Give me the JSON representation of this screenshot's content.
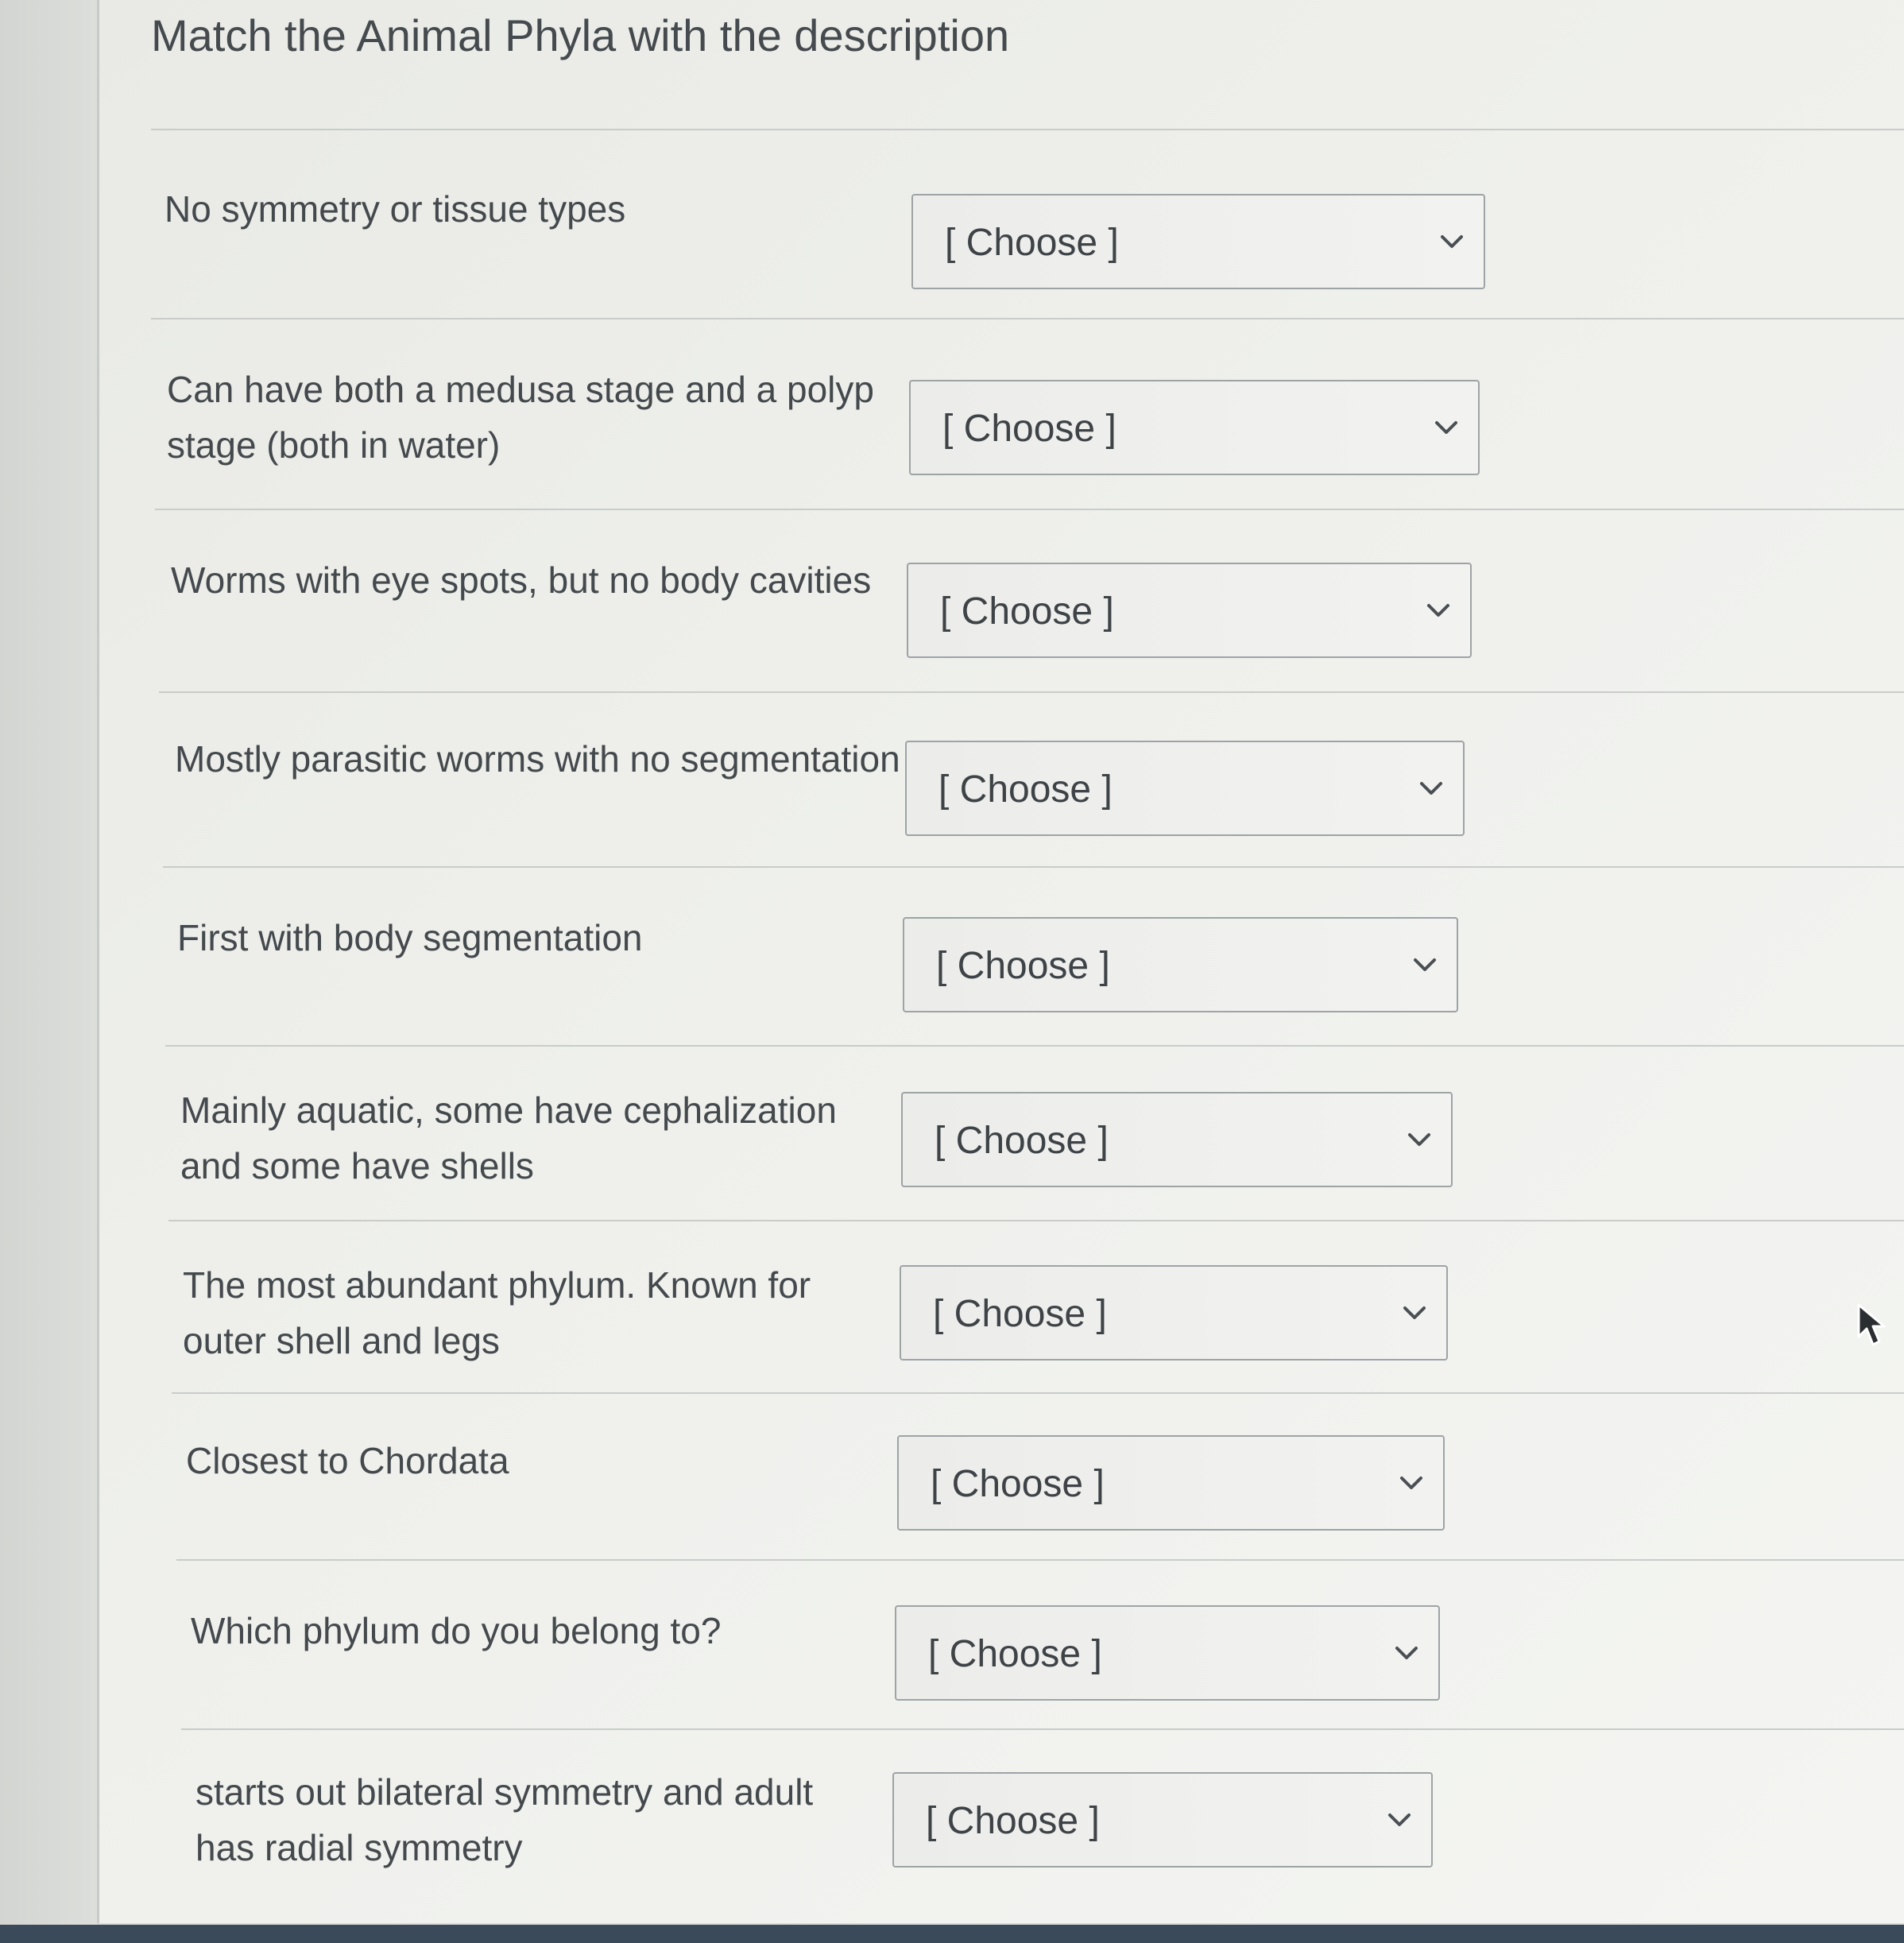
{
  "title": "Match the Animal Phyla with the description",
  "questions": [
    {
      "text": "No symmetry or tissue types",
      "selected": "[ Choose ]"
    },
    {
      "text": "Can have both a medusa stage and a polyp stage (both in water)",
      "selected": "[ Choose ]"
    },
    {
      "text": "Worms with eye spots, but no body cavities",
      "selected": "[ Choose ]"
    },
    {
      "text": "Mostly parasitic worms with no segmentation",
      "selected": "[ Choose ]"
    },
    {
      "text": "First with body segmentation",
      "selected": "[ Choose ]"
    },
    {
      "text": "Mainly aquatic, some have cephalization and some have shells",
      "selected": "[ Choose ]"
    },
    {
      "text": "The most abundant phylum. Known for outer shell and legs",
      "selected": "[ Choose ]"
    },
    {
      "text": "Closest to Chordata",
      "selected": "[ Choose ]"
    },
    {
      "text": "Which phylum do you belong to?",
      "selected": "[ Choose ]"
    },
    {
      "text": "starts out bilateral symmetry and adult has radial symmetry",
      "selected": "[ Choose ]"
    }
  ],
  "icons": {
    "dropdown": "chevron-down-icon",
    "pointer": "mouse-cursor-icon"
  }
}
